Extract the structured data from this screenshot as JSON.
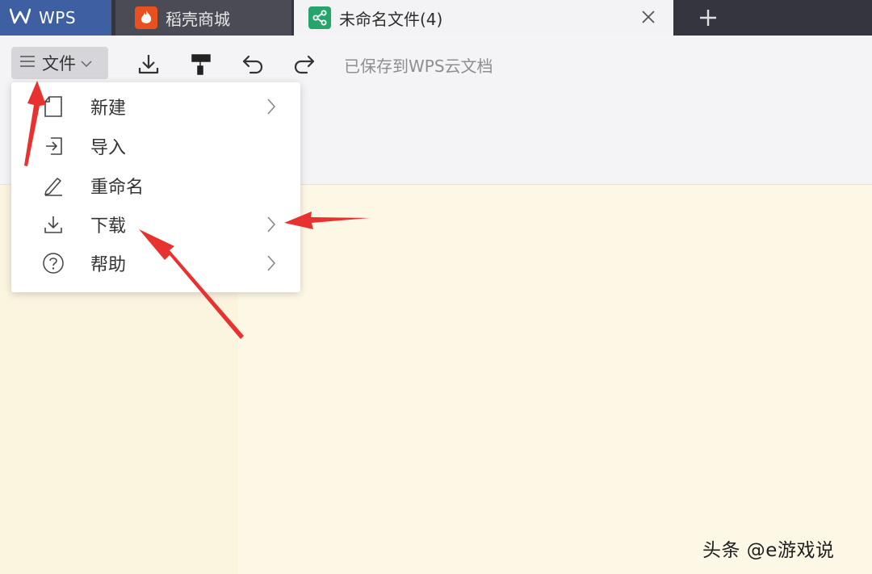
{
  "tabs": {
    "wps": {
      "label": "WPS"
    },
    "shop": {
      "label": "稻壳商城"
    },
    "doc": {
      "label": "未命名文件(4)"
    }
  },
  "toolbar": {
    "file_label": "文件",
    "save_status": "已保存到WPS云文档",
    "icons": [
      "download-icon",
      "format-painter-icon",
      "undo-icon",
      "redo-icon"
    ]
  },
  "menu": {
    "items": [
      {
        "label": "新建",
        "icon": "new-file-icon",
        "has_submenu": true
      },
      {
        "label": "导入",
        "icon": "import-icon",
        "has_submenu": false
      },
      {
        "label": "重命名",
        "icon": "rename-pencil-icon",
        "has_submenu": false
      },
      {
        "label": "下载",
        "icon": "download-icon",
        "has_submenu": true
      },
      {
        "label": "帮助",
        "icon": "help-icon",
        "has_submenu": true
      }
    ]
  },
  "watermark": {
    "text": "头条 @e游戏说"
  },
  "colors": {
    "wps_tab": "#3f5fa3",
    "shop_logo": "#e8501f",
    "doc_logo": "#25a56a",
    "annotation_arrow": "#e8322f",
    "document_bg": "#fdf8e6"
  }
}
